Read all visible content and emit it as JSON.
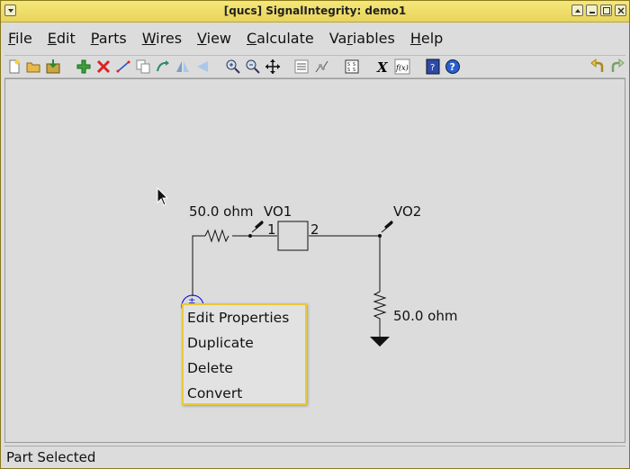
{
  "window": {
    "title": "[qucs] SignalIntegrity: demo1"
  },
  "menubar": {
    "items": [
      {
        "label": "File",
        "mnemonic": "F"
      },
      {
        "label": "Edit",
        "mnemonic": "E"
      },
      {
        "label": "Parts",
        "mnemonic": "P"
      },
      {
        "label": "Wires",
        "mnemonic": "W"
      },
      {
        "label": "View",
        "mnemonic": "V"
      },
      {
        "label": "Calculate",
        "mnemonic": "C"
      },
      {
        "label": "Variables",
        "mnemonic": "r"
      },
      {
        "label": "Help",
        "mnemonic": "H"
      }
    ]
  },
  "toolbar": {
    "icons": [
      "new-file-icon",
      "open-folder-icon",
      "save-icon",
      "add-part-icon",
      "delete-part-icon",
      "add-wire-icon",
      "duplicate-icon",
      "rotate-icon",
      "mirror-icon",
      "flip-icon",
      "zoom-in-icon",
      "zoom-out-icon",
      "pan-icon",
      "netlist-icon",
      "graph-icon",
      "matrix-icon",
      "variable-x-icon",
      "function-icon",
      "help-book-icon",
      "help-question-icon",
      "undo-icon",
      "redo-icon"
    ]
  },
  "schematic": {
    "resistor1_label": "50.0 ohm",
    "probe1_label": "VO1",
    "probe2_label": "VO2",
    "port1_label": "1",
    "port2_label": "2",
    "resistor2_label": "50.0 ohm",
    "source_symbol": "±"
  },
  "context_menu": {
    "items": [
      "Edit Properties",
      "Duplicate",
      "Delete",
      "Convert"
    ]
  },
  "status": {
    "text": "Part Selected"
  },
  "colors": {
    "titlebar": "#e8d45a",
    "menu_border": "#e8c93a",
    "selected_part": "#0000cc"
  }
}
